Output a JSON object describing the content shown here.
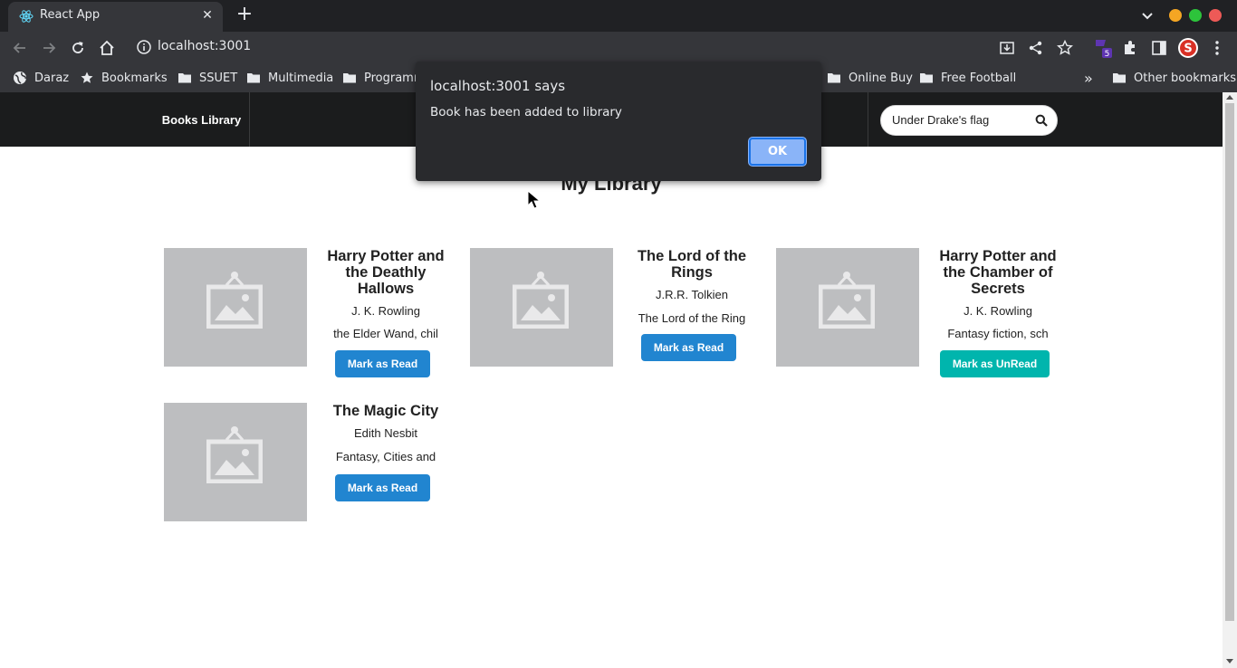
{
  "browser": {
    "tab_title": "React App",
    "url": "localhost:3001",
    "extension_badge": "5",
    "bookmarks": [
      {
        "label": "Daraz",
        "icon": "globe-icon"
      },
      {
        "label": "Bookmarks",
        "icon": "star-icon"
      },
      {
        "label": "SSUET",
        "icon": "folder-icon"
      },
      {
        "label": "Multimedia",
        "icon": "folder-icon"
      },
      {
        "label": "Programm",
        "icon": "folder-icon"
      },
      {
        "label": "Online Buy",
        "icon": "folder-icon"
      },
      {
        "label": "Free Football",
        "icon": "folder-icon"
      }
    ],
    "more_bookmarks": "»",
    "other_bookmarks": "Other bookmarks",
    "colors": {
      "close": "#ed5a57",
      "maximize": "#2dc43b",
      "minimize": "#f5a623",
      "accent": "#8ab4f8"
    }
  },
  "app": {
    "brand": "Books Library",
    "search_value": "Under Drake's flag",
    "heading": "My Library",
    "books": [
      {
        "title": "Harry Potter and the Deathly Hallows",
        "author": "J. K. Rowling",
        "description": "the Elder Wand, chil",
        "button": "Mark as Read"
      },
      {
        "title": "The Lord of the Rings",
        "author": "J.R.R. Tolkien",
        "description": "The Lord of the Ring",
        "button": "Mark as Read"
      },
      {
        "title": "Harry Potter and the Chamber of Secrets",
        "author": "J. K. Rowling",
        "description": "Fantasy fiction, sch",
        "button": "Mark as UnRead"
      },
      {
        "title": "The Magic City",
        "author": "Edith Nesbit",
        "description": "Fantasy, Cities and",
        "button": "Mark as Read"
      }
    ],
    "colors": {
      "read_button": "#2185d0",
      "unread_button": "#00b5ad",
      "navbar": "#1b1c1d"
    }
  },
  "alert": {
    "title": "localhost:3001 says",
    "message": "Book has been added to library",
    "ok_label": "OK"
  }
}
